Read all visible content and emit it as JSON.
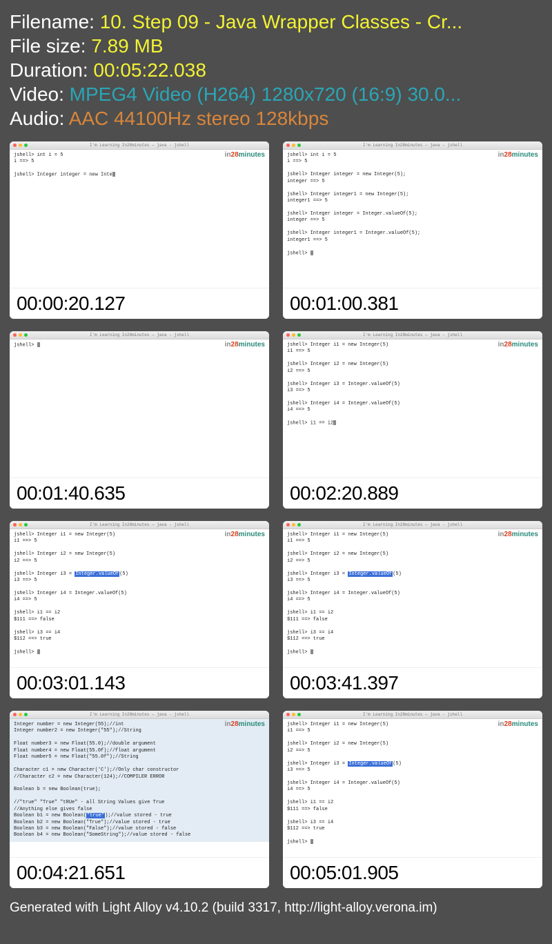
{
  "meta": {
    "filename_label": "Filename:",
    "filename_value": "10. Step 09 - Java Wrapper Classes - Cr...",
    "filesize_label": "File size:",
    "filesize_value": "7.89 MB",
    "duration_label": "Duration:",
    "duration_value": "00:05:22.038",
    "video_label": "Video:",
    "video_value": "MPEG4 Video (H264) 1280x720 (16:9) 30.0...",
    "audio_label": "Audio:",
    "audio_value": "AAC 44100Hz stereo 128kbps"
  },
  "titlebar_text": "I'm Learning In28minutes — java - jshell",
  "brand": {
    "pre": "in",
    "mid": "28",
    "suf": "minutes"
  },
  "thumbs": [
    {
      "time": "00:00:20.127",
      "code": "jshell> int i = 5\ni ==> 5\n\njshell> Integer integer = new Inte"
    },
    {
      "time": "00:01:00.381",
      "code": "jshell> int i = 5\ni ==> 5\n\njshell> Integer integer = new Integer(5);\ninteger ==> 5\n\njshell> Integer integer1 = new Integer(5);\ninteger1 ==> 5\n\njshell> Integer integer = Integer.valueOf(5);\ninteger ==> 5\n\njshell> Integer integer1 = Integer.valueOf(5);\ninteger1 ==> 5\n\njshell> "
    },
    {
      "time": "00:01:40.635",
      "code": "jshell> "
    },
    {
      "time": "00:02:20.889",
      "code": "jshell> Integer i1 = new Integer(5)\ni1 ==> 5\n\njshell> Integer i2 = new Integer(5)\ni2 ==> 5\n\njshell> Integer i3 = Integer.valueOf(5)\ni3 ==> 5\n\njshell> Integer i4 = Integer.valueOf(5)\ni4 ==> 5\n\njshell> i1 == i2"
    },
    {
      "time": "00:03:01.143",
      "hl": "Integer.valueOf",
      "code": "jshell> Integer i1 = new Integer(5)\ni1 ==> 5\n\njshell> Integer i2 = new Integer(5)\ni2 ==> 5\n\njshell> Integer i3 = {{HL}}(5)\ni3 ==> 5\n\njshell> Integer i4 = Integer.valueOf(5)\ni4 ==> 5\n\njshell> i1 == i2\n$111 ==> false\n\njshell> i3 == i4\n$112 ==> true\n\njshell> "
    },
    {
      "time": "00:03:41.397",
      "hl": "Integer.valueOf",
      "code": "jshell> Integer i1 = new Integer(5)\ni1 ==> 5\n\njshell> Integer i2 = new Integer(5)\ni2 ==> 5\n\njshell> Integer i3 = {{HL}}(5)\ni3 ==> 5\n\njshell> Integer i4 = Integer.valueOf(5)\ni4 ==> 5\n\njshell> i1 == i2\n$111 ==> false\n\njshell> i3 == i4\n$112 ==> true\n\njshell> "
    },
    {
      "time": "00:04:21.651",
      "bluebg": true,
      "hl": "\"true\"",
      "code": "Integer number = new Integer(55);//int\nInteger number2 = new Integer(\"55\");//String\n\nFloat number3 = new Float(55.0);//double argument\nFloat number4 = new Float(55.0f);//float argument\nFloat number5 = new Float(\"55.0f\");//String\n\nCharacter c1 = new Character('C');//Only char constructor\n//Character c2 = new Character(124);//COMPILER ERROR\n\nBoolean b = new Boolean(true);\n\n//\"true\" \"True\" \"tRUe\" - all String Values give True\n//Anything else gives false\nBoolean b1 = new Boolean({{HL}});//value stored - true\nBoolean b2 = new Boolean(\"True\");//value stored - true\nBoolean b3 = new Boolean(\"False\");//value stored - false\nBoolean b4 = new Boolean(\"SomeString\");//value stored - false"
    },
    {
      "time": "00:05:01.905",
      "hl": "Integer.valueOf",
      "code": "jshell> Integer i1 = new Integer(5)\ni1 ==> 5\n\njshell> Integer i2 = new Integer(5)\ni2 ==> 5\n\njshell> Integer i3 = {{HL}}(5)\ni3 ==> 5\n\njshell> Integer i4 = Integer.valueOf(5)\ni4 ==> 5\n\njshell> i1 == i2\n$111 ==> false\n\njshell> i3 == i4\n$112 ==> true\n\njshell> "
    }
  ],
  "footer": "Generated with Light Alloy v4.10.2 (build 3317, http://light-alloy.verona.im)"
}
